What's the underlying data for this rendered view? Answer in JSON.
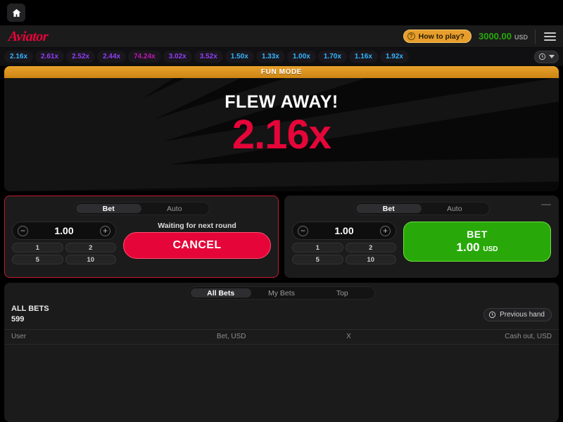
{
  "topbar": {
    "home_icon": "home-icon"
  },
  "header": {
    "logo": "Aviator",
    "how_to_play": "How to play?",
    "how_to_play_icon": "question-mark-icon",
    "balance_amount": "3000.00",
    "balance_currency": "USD",
    "menu_icon": "hamburger-menu-icon",
    "accent_orange": "#e79e2c",
    "balance_green": "#28a909",
    "brand_red": "#e50539"
  },
  "history": {
    "items": [
      {
        "value": "2.16x",
        "color_class": "blue"
      },
      {
        "value": "2.61x",
        "color_class": "purple"
      },
      {
        "value": "2.52x",
        "color_class": "purple"
      },
      {
        "value": "2.44x",
        "color_class": "purple"
      },
      {
        "value": "74.24x",
        "color_class": "pink"
      },
      {
        "value": "3.02x",
        "color_class": "purple"
      },
      {
        "value": "3.52x",
        "color_class": "purple"
      },
      {
        "value": "1.50x",
        "color_class": "blue"
      },
      {
        "value": "1.33x",
        "color_class": "blue"
      },
      {
        "value": "1.00x",
        "color_class": "blue"
      },
      {
        "value": "1.70x",
        "color_class": "blue"
      },
      {
        "value": "1.16x",
        "color_class": "blue"
      },
      {
        "value": "1.92x",
        "color_class": "blue"
      }
    ],
    "toggle_icon": "history-clock-icon",
    "toggle_caret_icon": "chevron-down-icon",
    "color_blue": "#34b3ff",
    "color_purple": "#913ef8",
    "color_pink": "#c017b4"
  },
  "canvas": {
    "fun_mode": "FUN MODE",
    "status": "FLEW AWAY!",
    "multiplier": "2.16x",
    "multiplier_color": "#e50539"
  },
  "bet_panels": [
    {
      "tab_bet": "Bet",
      "tab_auto": "Auto",
      "active_tab": "Bet",
      "amount": "1.00",
      "minus_icon": "minus-circle-icon",
      "plus_icon": "plus-circle-icon",
      "quick_amounts": [
        "1",
        "2",
        "5",
        "10"
      ],
      "status_text": "Waiting for next round",
      "action_label": "CANCEL",
      "action_state": "cancel",
      "action_color": "#e50539"
    },
    {
      "tab_bet": "Bet",
      "tab_auto": "Auto",
      "active_tab": "Bet",
      "amount": "1.00",
      "minus_icon": "minus-circle-icon",
      "plus_icon": "plus-circle-icon",
      "quick_amounts": [
        "1",
        "2",
        "5",
        "10"
      ],
      "status_text": "",
      "action_label": "BET",
      "action_amount": "1.00",
      "action_currency": "USD",
      "action_state": "bet",
      "action_color": "#28a909",
      "collapse_icon": "minus-icon"
    }
  ],
  "bottom": {
    "tabs": [
      {
        "label": "All Bets",
        "active": true
      },
      {
        "label": "My Bets",
        "active": false
      },
      {
        "label": "Top",
        "active": false
      }
    ],
    "all_bets_title": "ALL BETS",
    "all_bets_count": "599",
    "previous_hand": "Previous hand",
    "previous_hand_icon": "history-clock-icon",
    "columns": {
      "user": "User",
      "bet": "Bet, USD",
      "x": "X",
      "cashout": "Cash out, USD"
    },
    "rows": []
  }
}
